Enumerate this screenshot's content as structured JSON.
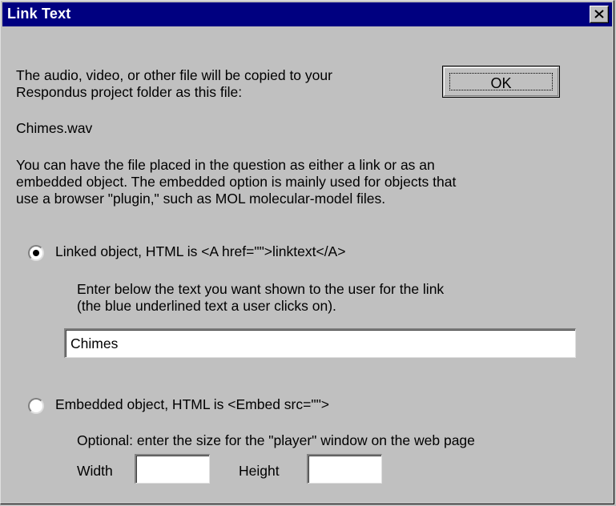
{
  "window": {
    "title": "Link Text"
  },
  "intro": {
    "line1": "The audio, video, or other file will be copied to your",
    "line2": "Respondus project folder as this file:"
  },
  "filename": "Chimes.wav",
  "description": {
    "line1": "You can have the file placed in the question as either a link or as an",
    "line2": "embedded object.   The embedded option is mainly used for objects that",
    "line3": "use a browser \"plugin,\" such as MOL molecular-model files."
  },
  "ok_button": {
    "label": "OK"
  },
  "linked": {
    "label": "Linked object,  HTML is  <A href=\"\">linktext</A>",
    "selected": true,
    "hint_line1": "Enter below the text you want shown to the user for the link",
    "hint_line2": "(the blue underlined text a user clicks on).",
    "link_text_value": "Chimes"
  },
  "embedded": {
    "label": "Embedded object,  HTML is  <Embed src=\"\">",
    "selected": false,
    "hint": "Optional:  enter the size for the \"player\" window on the web page",
    "width_label": "Width",
    "width_value": "",
    "height_label": "Height",
    "height_value": ""
  },
  "colors": {
    "titlebar": "#000080",
    "face": "#c0c0c0"
  }
}
